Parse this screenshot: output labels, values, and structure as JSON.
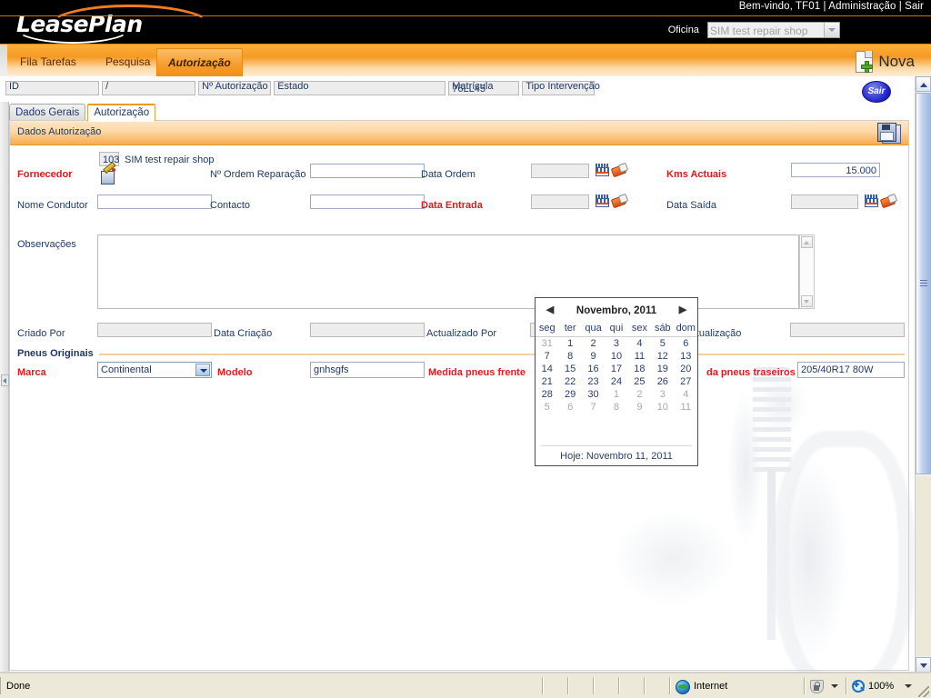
{
  "topbar": {
    "welcome_text": "Bem-vindo,  TF01  |   Administração |  Sair",
    "oficina_label": "Oficina",
    "oficina_value": "SIM test repair shop",
    "logo_text": "LeasePlan"
  },
  "nav": {
    "tabs": [
      {
        "label": "Fila Tarefas",
        "active": false
      },
      {
        "label": "Pesquisa",
        "active": false
      },
      {
        "label": "Autorização",
        "active": true
      }
    ],
    "nova_label": "Nova"
  },
  "idstrip": {
    "id_label": "ID",
    "id_value": "",
    "slash": "/",
    "id2_value": "",
    "num_autorizacao_label": "Nº Autorização",
    "num_autorizacao_value": "",
    "estado_label": "Estado",
    "estado_value": "",
    "matricula_label": "Matrícula",
    "matricula_value": "76LL45",
    "tipo_intervencao_label": "Tipo Intervenção",
    "tipo_intervencao_value": "",
    "sair_label": "Sair"
  },
  "subtabs": [
    {
      "label": "Dados Gerais",
      "active": false
    },
    {
      "label": "Autorização",
      "active": true
    }
  ],
  "panel": {
    "title": "Dados Autorização",
    "save_tooltip": "Guardar"
  },
  "form": {
    "fornecedor_label": "Fornecedor",
    "fornecedor_code": "103",
    "fornecedor_name": "SIM test repair shop",
    "num_ordem_label": "Nº Ordem Reparação",
    "num_ordem_value": "",
    "data_ordem_label": "Data Ordem",
    "data_ordem_value": "",
    "kms_actuais_label": "Kms Actuais",
    "kms_actuais_value": "15.000",
    "nome_condutor_label": "Nome Condutor",
    "nome_condutor_value": "",
    "contacto_label": "Contacto",
    "contacto_value": "",
    "data_entrada_label": "Data Entrada",
    "data_entrada_value": "",
    "data_saida_label": "Data Saída",
    "data_saida_value": "",
    "observacoes_label": "Observações",
    "observacoes_value": "",
    "criado_por_label": "Criado Por",
    "criado_por_value": "",
    "data_criacao_label": "Data Criação",
    "data_criacao_value": "",
    "actualizado_por_label": "Actualizado Por",
    "actualizado_por_value": "",
    "data_actualizacao_label": "Actualização",
    "data_actualizacao_value": "",
    "pneus_originais_label": "Pneus Originais",
    "marca_label": "Marca",
    "marca_value": "Continental",
    "modelo_label": "Modelo",
    "modelo_value": "gnhsgfs",
    "medida_frente_label": "Medida pneus frente",
    "medida_frente_value": "",
    "medida_traseiros_label": "da pneus traseiros",
    "medida_traseiros_value": "205/40R17 80W"
  },
  "calendar": {
    "month_year": "Novembro, 2011",
    "prev_glyph": "◀",
    "next_glyph": "▶",
    "weekdays": [
      "seg",
      "ter",
      "qua",
      "qui",
      "sex",
      "sáb",
      "dom"
    ],
    "weeks": [
      [
        {
          "d": "31",
          "out": true
        },
        {
          "d": "1",
          "out": false
        },
        {
          "d": "2",
          "out": false
        },
        {
          "d": "3",
          "out": false
        },
        {
          "d": "4",
          "out": false
        },
        {
          "d": "5",
          "out": false
        },
        {
          "d": "6",
          "out": false
        }
      ],
      [
        {
          "d": "7",
          "out": false
        },
        {
          "d": "8",
          "out": false
        },
        {
          "d": "9",
          "out": false
        },
        {
          "d": "10",
          "out": false
        },
        {
          "d": "11",
          "out": false
        },
        {
          "d": "12",
          "out": false
        },
        {
          "d": "13",
          "out": false
        }
      ],
      [
        {
          "d": "14",
          "out": false
        },
        {
          "d": "15",
          "out": false
        },
        {
          "d": "16",
          "out": false
        },
        {
          "d": "17",
          "out": false
        },
        {
          "d": "18",
          "out": false
        },
        {
          "d": "19",
          "out": false
        },
        {
          "d": "20",
          "out": false
        }
      ],
      [
        {
          "d": "21",
          "out": false
        },
        {
          "d": "22",
          "out": false
        },
        {
          "d": "23",
          "out": false
        },
        {
          "d": "24",
          "out": false
        },
        {
          "d": "25",
          "out": false
        },
        {
          "d": "26",
          "out": false
        },
        {
          "d": "27",
          "out": false
        }
      ],
      [
        {
          "d": "28",
          "out": false
        },
        {
          "d": "29",
          "out": false
        },
        {
          "d": "30",
          "out": false
        },
        {
          "d": "1",
          "out": true
        },
        {
          "d": "2",
          "out": true
        },
        {
          "d": "3",
          "out": true
        },
        {
          "d": "4",
          "out": true
        }
      ],
      [
        {
          "d": "5",
          "out": true
        },
        {
          "d": "6",
          "out": true
        },
        {
          "d": "7",
          "out": true
        },
        {
          "d": "8",
          "out": true
        },
        {
          "d": "9",
          "out": true
        },
        {
          "d": "10",
          "out": true
        },
        {
          "d": "11",
          "out": true
        }
      ]
    ],
    "today_text": "Hoje: Novembro 11, 2011"
  },
  "statusbar": {
    "status_text": "Done",
    "zone_text": "Internet",
    "zoom_text": "100%"
  },
  "colors": {
    "brand_orange": "#f0981f",
    "required_red": "#e01b1b",
    "label_blue": "#1f3864",
    "header_black": "#000000"
  }
}
